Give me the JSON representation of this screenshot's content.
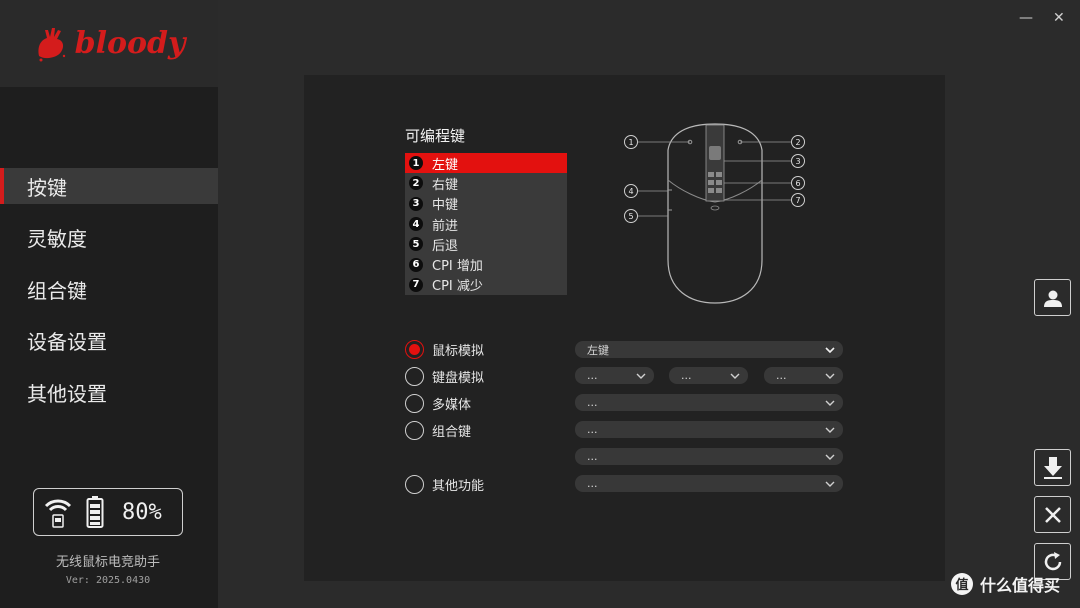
{
  "brand": {
    "logo_text": "bloody"
  },
  "nav": {
    "items": [
      {
        "label": "按键",
        "active": true
      },
      {
        "label": "灵敏度"
      },
      {
        "label": "组合键"
      },
      {
        "label": "设备设置"
      },
      {
        "label": "其他设置"
      }
    ]
  },
  "status": {
    "battery": "80%",
    "app_name": "无线鼠标电竞助手",
    "version": "Ver: 2025.0430"
  },
  "window": {
    "minimize": "—",
    "close": "✕"
  },
  "keys": {
    "title": "可编程键",
    "items": [
      {
        "num": "1",
        "label": "左键",
        "selected": true
      },
      {
        "num": "2",
        "label": "右键"
      },
      {
        "num": "3",
        "label": "中键"
      },
      {
        "num": "4",
        "label": "前进"
      },
      {
        "num": "5",
        "label": "后退"
      },
      {
        "num": "6",
        "label": "CPI 增加"
      },
      {
        "num": "7",
        "label": "CPI 减少"
      }
    ]
  },
  "diagram": {
    "callouts": [
      "1",
      "2",
      "3",
      "4",
      "5",
      "6",
      "7"
    ]
  },
  "options": {
    "mouse_sim": {
      "label": "鼠标模拟",
      "value": "左键"
    },
    "keyboard_sim": {
      "label": "键盘模拟",
      "values": [
        "...",
        "...",
        "..."
      ]
    },
    "multimedia": {
      "label": "多媒体",
      "value": "..."
    },
    "combo": {
      "label": "组合键",
      "value": "...",
      "value2": "..."
    },
    "other": {
      "label": "其他功能",
      "value": "..."
    }
  },
  "watermark": {
    "text": "什么值得买",
    "badge": "值"
  },
  "colors": {
    "accent": "#e3110f",
    "sidebar": "#1e1e1e",
    "panel": "#222222"
  }
}
